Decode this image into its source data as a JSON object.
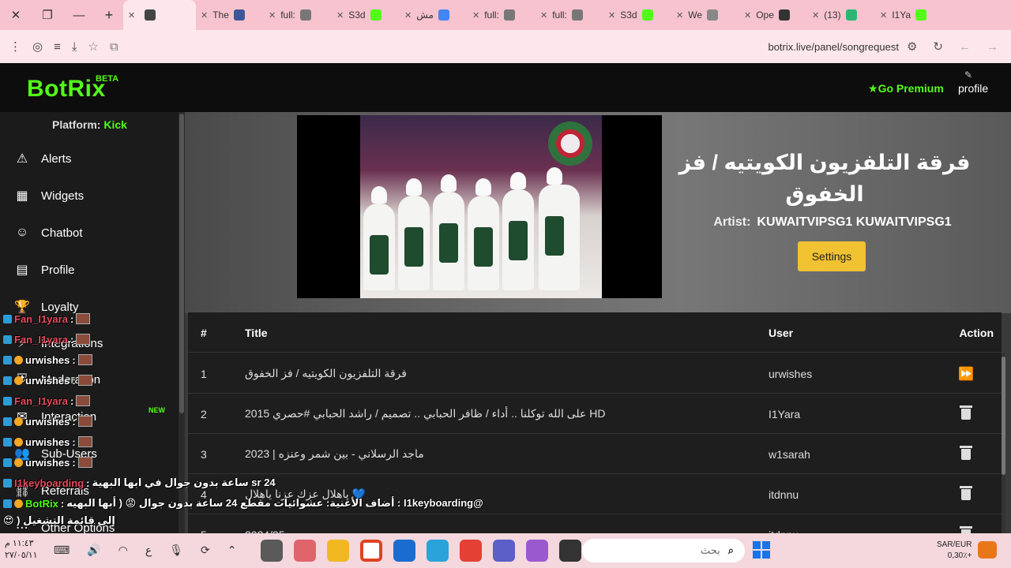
{
  "browser": {
    "tabs": [
      {
        "label": "",
        "fav_color": "#444444",
        "active": true
      },
      {
        "label": "The",
        "fav_color": "#3b5998"
      },
      {
        "label": "full:",
        "fav_color": "#777777"
      },
      {
        "label": "S3d",
        "fav_color": "#53fc18"
      },
      {
        "label": "مش",
        "fav_color": "#4285f4"
      },
      {
        "label": "full:",
        "fav_color": "#777777"
      },
      {
        "label": "full:",
        "fav_color": "#777777"
      },
      {
        "label": "S3d",
        "fav_color": "#53fc18"
      },
      {
        "label": "We",
        "fav_color": "#888888"
      },
      {
        "label": "Ope",
        "fav_color": "#333333"
      },
      {
        "label": "(13)",
        "fav_color": "#2bb673"
      },
      {
        "label": "I1Ya",
        "fav_color": "#53fc18"
      }
    ],
    "url": "botrix.live/panel/songrequest"
  },
  "header": {
    "logo": "BotRix",
    "beta": "BETA",
    "premium": "Go Premium",
    "profile": "profile"
  },
  "sidebar": {
    "platform_label": "Platform:",
    "platform_value": "Kick",
    "items": [
      {
        "label": "Alerts",
        "icon": "warning-icon"
      },
      {
        "label": "Widgets",
        "icon": "grid-icon"
      },
      {
        "label": "Chatbot",
        "icon": "robot-icon"
      },
      {
        "label": "Profile",
        "icon": "id-card-icon"
      },
      {
        "label": "Loyalty",
        "icon": "trophy-icon"
      },
      {
        "label": "Integrations",
        "icon": "plug-icon"
      },
      {
        "label": "Moderation",
        "icon": "shield-icon"
      },
      {
        "label": "Interaction",
        "icon": "chat-icon"
      },
      {
        "label": "Sub-Users",
        "icon": "users-icon"
      },
      {
        "label": "Referrals",
        "icon": "link-icon"
      },
      {
        "label": "Other Options",
        "icon": "dots-icon"
      }
    ],
    "new_badge": "NEW"
  },
  "player": {
    "title": "فرقة التلفزيون الكويتيه / فز الخفوق",
    "artist_label": "Artist:",
    "artist": "KUWAITVIPSG1 KUWAITVIPSG1",
    "settings": "Settings"
  },
  "queue": {
    "headers": {
      "num": "#",
      "title": "Title",
      "user": "User",
      "action": "Action"
    },
    "rows": [
      {
        "num": "1",
        "title": "فرقة التلفزيون الكويتيه / فز الخفوق",
        "user": "urwishes",
        "action": "skip"
      },
      {
        "num": "2",
        "title": "HD على الله توكلنا .. أداء / ظافر الحبابي .. تصميم / راشد الحبابي #حصري 2015",
        "user": "I1Yara",
        "action": "delete"
      },
      {
        "num": "3",
        "title": "ماجد الرسلاني - بين شمر وعنزه | 2023",
        "user": "w1sarah",
        "action": "delete"
      },
      {
        "num": "4",
        "title": "💙 ياهلال عزك عزنا ياهلال",
        "user": "itdnnu",
        "action": "delete"
      },
      {
        "num": "5",
        "title": "2024/25",
        "user": "itdnnu",
        "action": "delete"
      }
    ]
  },
  "chat": [
    {
      "user": "Fan_I1yara",
      "style": "u-fan",
      "msg": ""
    },
    {
      "user": "Fan_I1yara",
      "style": "u-fan",
      "msg": ""
    },
    {
      "user": "urwishes",
      "style": "u-urw",
      "msg": ""
    },
    {
      "user": "urwishes",
      "style": "u-urw",
      "msg": ""
    },
    {
      "user": "Fan_I1yara",
      "style": "u-fan",
      "msg": ""
    },
    {
      "user": "urwishes",
      "style": "u-urw",
      "msg": ""
    },
    {
      "user": "urwishes",
      "style": "u-urw",
      "msg": ""
    },
    {
      "user": "urwishes",
      "style": "u-urw",
      "msg": ""
    },
    {
      "user": "I1keyboarding",
      "style": "u-i1k",
      "msg": "sr 24 ساعة بدون جوال في ابها البهية"
    },
    {
      "user": "BotRix",
      "style": "u-bot",
      "msg": "@I1keyboarding : أضاف الأغنية: عشوائيات مقطع 24 ساعة بدون جوال 😡 ( أبها البهيه"
    },
    {
      "user": "",
      "style": "u-urw",
      "msg": "إلى قائمة التشغيل ( 😍"
    }
  ],
  "taskbar": {
    "time": "١١:٤٣ م",
    "date": "٢٧/٠٥/١١",
    "lang": "ع",
    "search": "بحث",
    "currency": "SAR/EUR",
    "rate": "0,30٪+"
  }
}
